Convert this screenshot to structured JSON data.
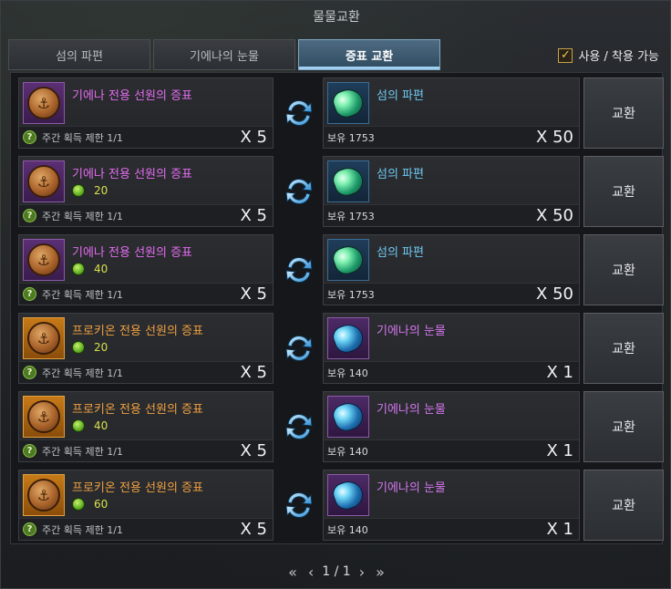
{
  "window": {
    "title": "물물교환"
  },
  "tabs": [
    {
      "label": "섬의 파편",
      "active": false
    },
    {
      "label": "기에나의 눈물",
      "active": false
    },
    {
      "label": "증표 교환",
      "active": true
    }
  ],
  "filter": {
    "checked": true,
    "label": "사용 / 착용 가능",
    "check_mark": "✓"
  },
  "rows": [
    {
      "give": {
        "name": "기에나 전용 선원의 증표",
        "color": "purple",
        "cost": "",
        "limit": "주간 획득 제한 1/1",
        "qty": "X 5"
      },
      "receive": {
        "name": "섬의 파편",
        "color": "blue",
        "gem": "green",
        "owned": "보유 1753",
        "qty": "X 50"
      },
      "button": "교환"
    },
    {
      "give": {
        "name": "기에나 전용 선원의 증표",
        "color": "purple",
        "cost": "20",
        "limit": "주간 획득 제한 1/1",
        "qty": "X 5"
      },
      "receive": {
        "name": "섬의 파편",
        "color": "blue",
        "gem": "green",
        "owned": "보유 1753",
        "qty": "X 50"
      },
      "button": "교환"
    },
    {
      "give": {
        "name": "기에나 전용 선원의 증표",
        "color": "purple",
        "cost": "40",
        "limit": "주간 획득 제한 1/1",
        "qty": "X 5"
      },
      "receive": {
        "name": "섬의 파편",
        "color": "blue",
        "gem": "green",
        "owned": "보유 1753",
        "qty": "X 50"
      },
      "button": "교환"
    },
    {
      "give": {
        "name": "프로키온 전용 선원의 증표",
        "color": "orange",
        "cost": "20",
        "limit": "주간 획득 제한 1/1",
        "qty": "X 5"
      },
      "receive": {
        "name": "기에나의 눈물",
        "color": "purple",
        "gem": "blue",
        "owned": "보유 140",
        "qty": "X 1"
      },
      "button": "교환"
    },
    {
      "give": {
        "name": "프로키온 전용 선원의 증표",
        "color": "orange",
        "cost": "40",
        "limit": "주간 획득 제한 1/1",
        "qty": "X 5"
      },
      "receive": {
        "name": "기에나의 눈물",
        "color": "purple",
        "gem": "blue",
        "owned": "보유 140",
        "qty": "X 1"
      },
      "button": "교환"
    },
    {
      "give": {
        "name": "프로키온 전용 선원의 증표",
        "color": "orange",
        "cost": "60",
        "limit": "주간 획득 제한 1/1",
        "qty": "X 5"
      },
      "receive": {
        "name": "기에나의 눈물",
        "color": "purple",
        "gem": "blue",
        "owned": "보유 140",
        "qty": "X 1"
      },
      "button": "교환"
    }
  ],
  "pager": {
    "first": "«",
    "prev": "‹",
    "page": "1 / 1",
    "next": "›",
    "last": "»"
  },
  "icons": {
    "help": "?",
    "coin": "⚓"
  }
}
